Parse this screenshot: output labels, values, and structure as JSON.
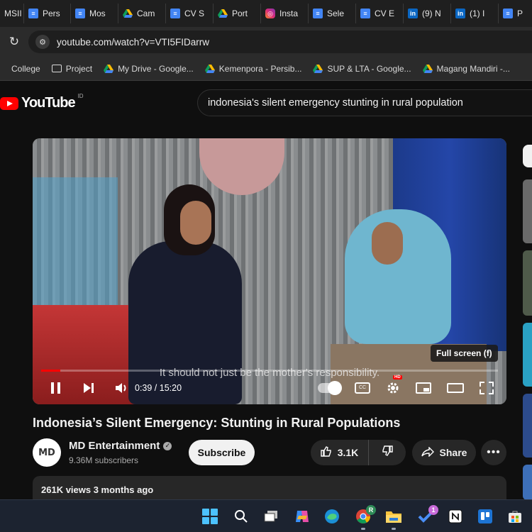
{
  "tabs": [
    {
      "label": "MSII",
      "icon": "ms-icon"
    },
    {
      "label": "Pers",
      "icon": "docs-icon"
    },
    {
      "label": "Mos",
      "icon": "docs-icon"
    },
    {
      "label": "Cam",
      "icon": "drive-icon"
    },
    {
      "label": "CV S",
      "icon": "docs-icon"
    },
    {
      "label": "Port",
      "icon": "drive-icon"
    },
    {
      "label": "Insta",
      "icon": "instagram-icon"
    },
    {
      "label": "Sele",
      "icon": "docs-icon"
    },
    {
      "label": "CV E",
      "icon": "docs-icon"
    },
    {
      "label": "(9) N",
      "icon": "linkedin-icon"
    },
    {
      "label": "(1) I",
      "icon": "linkedin-icon"
    },
    {
      "label": "P",
      "icon": "docs-icon"
    }
  ],
  "address_bar": {
    "url": "youtube.com/watch?v=VTI5FIDarrw"
  },
  "bookmarks": [
    {
      "label": "College",
      "icon": "folder-icon"
    },
    {
      "label": "Project",
      "icon": "folder-icon"
    },
    {
      "label": "My Drive - Google...",
      "icon": "drive-icon"
    },
    {
      "label": "Kemenpora - Persib...",
      "icon": "drive-icon"
    },
    {
      "label": "SUP & LTA - Google...",
      "icon": "drive-icon"
    },
    {
      "label": "Magang Mandiri -...",
      "icon": "drive-icon"
    }
  ],
  "youtube": {
    "logo_text": "YouTube",
    "region": "ID",
    "search_value": "indonesia's silent emergency stunting in rural population"
  },
  "player": {
    "subtitle": "It should not just be the mother's responsibility.",
    "tooltip": "Full screen (f)",
    "time": "0:39 / 15:20",
    "progress_fraction": 0.042,
    "hd_badge": "HD",
    "cc_label": "CC"
  },
  "video": {
    "title": "Indonesia’s Silent Emergency: Stunting in Rural Populations",
    "channel_name": "MD Entertainment",
    "avatar_text": "MD",
    "subscribers": "9.36M subscribers",
    "subscribe_label": "Subscribe",
    "likes": "3.1K",
    "share_label": "Share",
    "meta": "261K views  3 months ago"
  },
  "taskbar": {
    "chrome_badge": "R",
    "todo_badge": "1"
  },
  "colors": {
    "youtube_red": "#ff0000",
    "background": "#0f0f0f",
    "chip_background": "#272727",
    "windows_accent": "#4cc2ff"
  }
}
